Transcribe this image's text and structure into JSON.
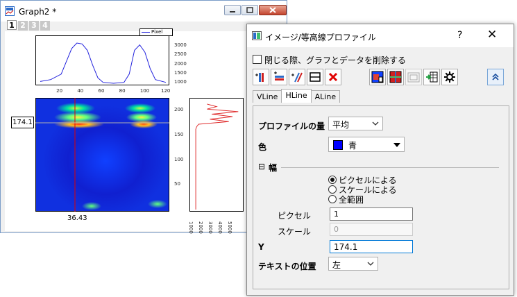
{
  "graph_window": {
    "title": "Graph2 *",
    "layers": [
      "1",
      "2",
      "3",
      "4"
    ],
    "legend_label": "Pixel",
    "cursor_y_label": "174.1",
    "cursor_x_label": "36.43",
    "top_panel": {
      "x_ticks": [
        "20",
        "40",
        "60",
        "80",
        "100",
        "120"
      ],
      "y_ticks": [
        "3000",
        "2500",
        "2000",
        "1500",
        "1000"
      ]
    },
    "image_y_ticks": [
      "200",
      "150",
      "100",
      "50"
    ],
    "side_panel_x_ticks": [
      "1000",
      "2000",
      "3000",
      "4000",
      "5000"
    ]
  },
  "chart_data": [
    {
      "type": "line",
      "x": [
        0,
        10,
        20,
        25,
        30,
        35,
        40,
        45,
        50,
        55,
        60,
        70,
        80,
        85,
        90,
        95,
        100,
        105,
        110,
        120
      ],
      "series": [
        {
          "name": "Pixel",
          "values": [
            1100,
            1200,
            1500,
            2200,
            2900,
            3200,
            3150,
            2800,
            2000,
            1300,
            1050,
            1000,
            1050,
            1500,
            2800,
            3100,
            2700,
            1800,
            1200,
            1050
          ]
        }
      ],
      "xlim": [
        0,
        120
      ],
      "ylim": [
        1000,
        3200
      ]
    },
    {
      "type": "line",
      "y": [
        210,
        205,
        200,
        195,
        190,
        185,
        180,
        175,
        170,
        165,
        160,
        150,
        120,
        100,
        80,
        60,
        40,
        20,
        0
      ],
      "series": [
        {
          "values": [
            1500,
            2500,
            1500,
            4800,
            2000,
            4200,
            1800,
            3800,
            600,
            400,
            300,
            300,
            300,
            300,
            300,
            300,
            300,
            300,
            300
          ]
        }
      ],
      "xlim": [
        0,
        5000
      ],
      "ylim": [
        0,
        210
      ]
    }
  ],
  "dialog": {
    "title": "イメージ/等高線プロファイル",
    "help": "?",
    "close": "✕",
    "checkbox_label": "閉じる際、グラフとデータを削除する",
    "tabs": [
      "VLine",
      "HLine",
      "ALine"
    ],
    "active_tab": "HLine",
    "profile_amount_label": "プロファイルの量",
    "profile_amount_value": "平均",
    "color_label": "色",
    "color_value": "青",
    "color_swatch": "#0000ff",
    "width_section_label": "幅",
    "collapse_glyph": "⊟",
    "width_options": [
      "ピクセルによる",
      "スケールによる",
      "全範囲"
    ],
    "selected_width_option": 0,
    "pixel_label": "ピクセル",
    "pixel_value": "1",
    "scale_label": "スケール",
    "scale_value": "0",
    "y_label": "Y",
    "y_value": "174.1",
    "text_position_label": "テキストの位置",
    "text_position_value": "左"
  },
  "colors": {
    "line": "#2222dd",
    "cursor": "#e00000",
    "side_line": "#e03030"
  }
}
